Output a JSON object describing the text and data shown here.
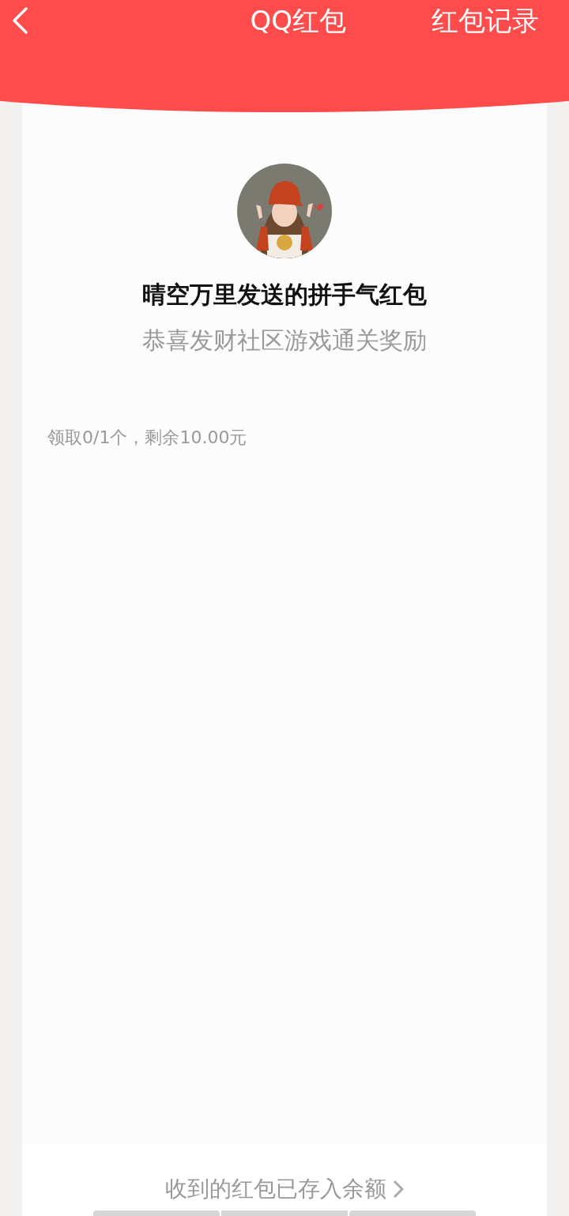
{
  "header": {
    "title": "QQ红包",
    "records_link": "红包记录"
  },
  "packet": {
    "sender_line": "晴空万里发送的拼手气红包",
    "blessing": "恭喜发财社区游戏通关奖励",
    "summary": "领取0/1个，剩余10.00元"
  },
  "footer": {
    "note": "收到的红包已存入余额"
  }
}
